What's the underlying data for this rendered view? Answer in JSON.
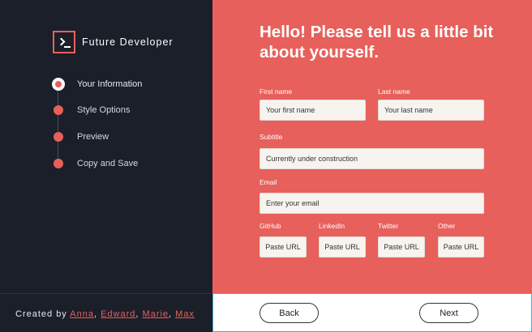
{
  "brand": {
    "name": "Future Developer"
  },
  "steps": [
    {
      "label": "Your Information"
    },
    {
      "label": "Style Options"
    },
    {
      "label": "Preview"
    },
    {
      "label": "Copy and Save"
    }
  ],
  "credits": {
    "prefix": "Created by",
    "authors": [
      "Anna",
      "Edward",
      "Marie",
      "Max"
    ]
  },
  "form": {
    "heading": "Hello! Please tell us a little bit about yourself.",
    "first_name": {
      "label": "First name",
      "placeholder": "Your first name"
    },
    "last_name": {
      "label": "Last name",
      "placeholder": "Your last name"
    },
    "subtitle": {
      "label": "Subtitle",
      "value": "Currently under construction"
    },
    "email": {
      "label": "Email",
      "placeholder": "Enter your email"
    },
    "github": {
      "label": "GitHub",
      "placeholder": "Paste URL"
    },
    "linkedin": {
      "label": "LinkedIn",
      "placeholder": "Paste URL"
    },
    "twitter": {
      "label": "Twitter",
      "placeholder": "Paste URL"
    },
    "other": {
      "label": "Other",
      "placeholder": "Paste URL"
    }
  },
  "nav": {
    "back_label": "Back",
    "next_label": "Next"
  },
  "colors": {
    "accent": "#e8605b",
    "sidebar_bg": "#1b1f29",
    "field_bg": "#f7f4f0"
  }
}
